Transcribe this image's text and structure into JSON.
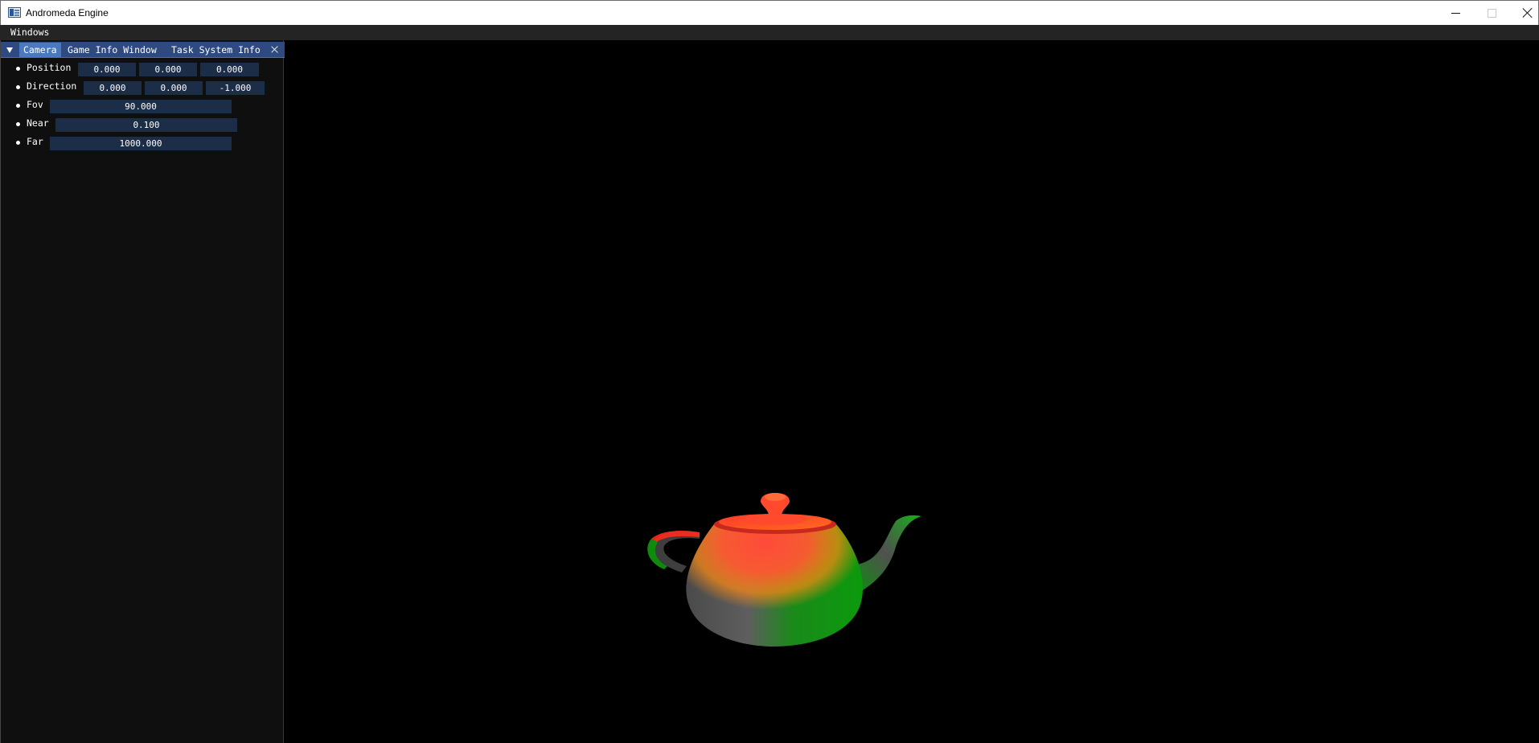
{
  "window": {
    "title": "Andromeda Engine"
  },
  "menubar": {
    "items": [
      "Windows"
    ]
  },
  "dock": {
    "tabs": [
      {
        "label": "Camera",
        "active": true
      },
      {
        "label": "Game Info Window",
        "active": false
      },
      {
        "label": "Task System Info",
        "active": false
      }
    ]
  },
  "camera": {
    "position": {
      "label": "Position",
      "values": [
        "0.000",
        "0.000",
        "0.000"
      ]
    },
    "direction": {
      "label": "Direction",
      "values": [
        "0.000",
        "0.000",
        "-1.000"
      ]
    },
    "fov": {
      "label": "Fov",
      "value": "90.000"
    },
    "near": {
      "label": "Near",
      "value": "0.100"
    },
    "far": {
      "label": "Far",
      "value": "1000.000"
    }
  },
  "viewport": {
    "object": "teapot",
    "colors": {
      "red": "#ff2a2a",
      "orange": "#ff8a00",
      "green": "#10a010",
      "gray": "#5a5a5a",
      "background": "#000000"
    }
  },
  "colors": {
    "tab_bar": "#2e4a80",
    "active_tab": "#4a79bf",
    "field_bg": "#1c2d47",
    "panel_bg": "#0f0f0f"
  }
}
